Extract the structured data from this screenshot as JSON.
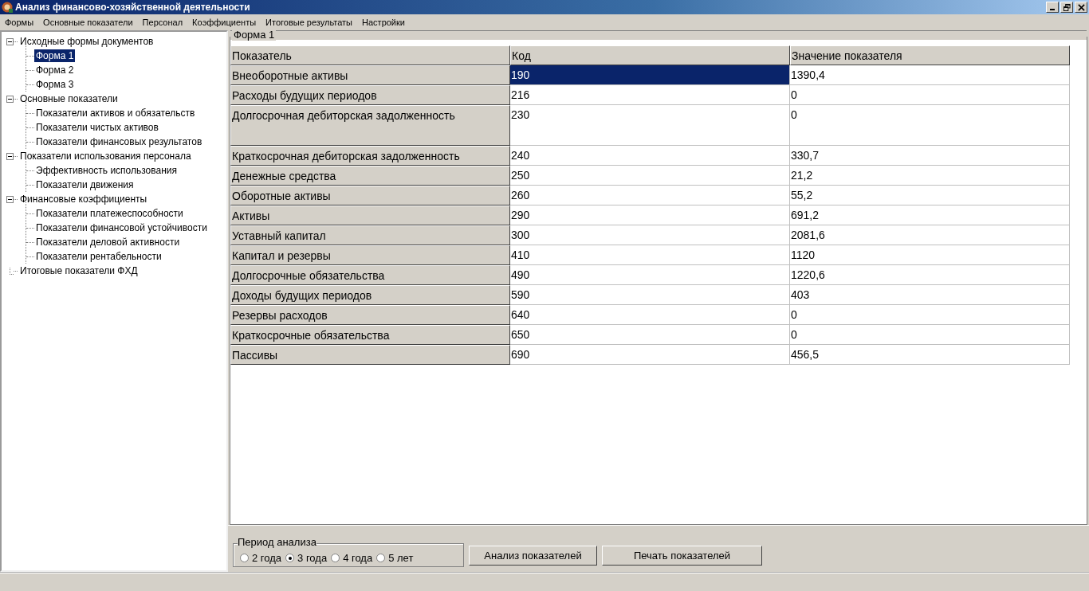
{
  "window": {
    "title": "Анализ финансово-хозяйственной деятельности"
  },
  "menu": [
    "Формы",
    "Основные показатели",
    "Персонал",
    "Коэффициенты",
    "Итоговые результаты",
    "Настройки"
  ],
  "tree": [
    {
      "label": "Исходные формы документов",
      "selected": false,
      "expanded": true,
      "children": [
        {
          "label": "Форма 1",
          "selected": true
        },
        {
          "label": "Форма 2",
          "selected": false
        },
        {
          "label": "Форма 3",
          "selected": false
        }
      ]
    },
    {
      "label": "Основные показатели",
      "selected": false,
      "expanded": true,
      "children": [
        {
          "label": "Показатели активов и обязательств",
          "selected": false
        },
        {
          "label": "Показатели чистых активов",
          "selected": false
        },
        {
          "label": "Показатели финансовых результатов",
          "selected": false
        }
      ]
    },
    {
      "label": "Показатели  использования персонала",
      "selected": false,
      "expanded": true,
      "children": [
        {
          "label": "Эффективность использования",
          "selected": false
        },
        {
          "label": "Показатели движения",
          "selected": false
        }
      ]
    },
    {
      "label": "Финансовые коэффициенты",
      "selected": false,
      "expanded": true,
      "children": [
        {
          "label": "Показатели платежеспособности",
          "selected": false
        },
        {
          "label": "Показатели финансовой устойчивости",
          "selected": false
        },
        {
          "label": "Показатели деловой активности",
          "selected": false
        },
        {
          "label": "Показатели рентабельности",
          "selected": false
        }
      ]
    },
    {
      "label": "Итоговые показатели ФХД",
      "selected": false
    }
  ],
  "form": {
    "title": "Форма 1",
    "columns": [
      "Показатель",
      "Код",
      "Значение показателя"
    ],
    "rows": [
      {
        "name": "Внеоборотные активы",
        "code": "190",
        "value": "1390,4",
        "selected": true,
        "kind": "normal"
      },
      {
        "name": "Расходы будущих периодов",
        "code": "216",
        "value": "0",
        "selected": false,
        "kind": "normal"
      },
      {
        "name": "Долгосрочная дебиторская задолженность",
        "code": "230",
        "value": "0",
        "selected": false,
        "kind": "tall"
      },
      {
        "name": "Краткосрочная дебиторская задолженность",
        "code": "240",
        "value": "330,7",
        "selected": false,
        "kind": "normal"
      },
      {
        "name": "Денежные средства",
        "code": "250",
        "value": "21,2",
        "selected": false,
        "kind": "normal"
      },
      {
        "name": "Оборотные активы",
        "code": "260",
        "value": "55,2",
        "selected": false,
        "kind": "normal"
      },
      {
        "name": "Активы",
        "code": "290",
        "value": "691,2",
        "selected": false,
        "kind": "normal"
      },
      {
        "name": "Уставный капитал",
        "code": "300",
        "value": "2081,6",
        "selected": false,
        "kind": "normal"
      },
      {
        "name": "Капитал и резервы",
        "code": "410",
        "value": "1120",
        "selected": false,
        "kind": "normal"
      },
      {
        "name": "Долгосрочные обязательства",
        "code": "490",
        "value": "1220,6",
        "selected": false,
        "kind": "normal"
      },
      {
        "name": "Доходы будущих периодов",
        "code": "590",
        "value": "403",
        "selected": false,
        "kind": "normal"
      },
      {
        "name": "Резервы расходов",
        "code": "640",
        "value": "0",
        "selected": false,
        "kind": "normal"
      },
      {
        "name": "Краткосрочные обязательства",
        "code": "650",
        "value": "0",
        "selected": false,
        "kind": "normal"
      },
      {
        "name": "Пассивы",
        "code": "690",
        "value": "456,5",
        "selected": false,
        "kind": "normal"
      }
    ]
  },
  "period": {
    "title": "Период анализа",
    "options": [
      {
        "label": "2 года",
        "selected": false
      },
      {
        "label": "3 года",
        "selected": true
      },
      {
        "label": "4 года",
        "selected": false
      },
      {
        "label": "5 лет",
        "selected": false
      }
    ]
  },
  "buttons": [
    "Анализ показателей",
    "Печать показателей"
  ]
}
